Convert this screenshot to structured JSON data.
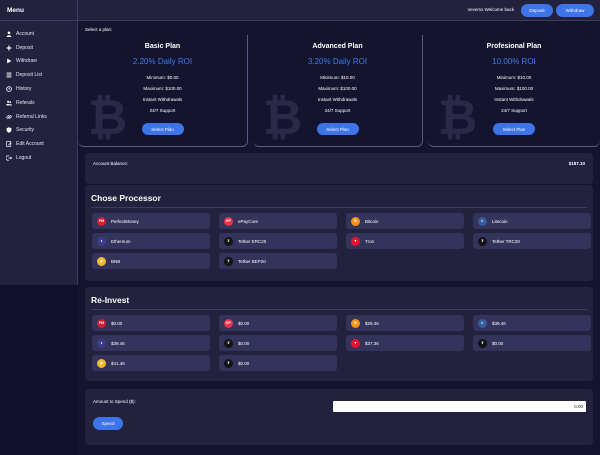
{
  "sidebar": {
    "title": "Menu",
    "items": [
      {
        "label": "Account",
        "icon": "user-icon"
      },
      {
        "label": "Deposit",
        "icon": "plus-icon"
      },
      {
        "label": "Withdraw",
        "icon": "withdraw-icon"
      },
      {
        "label": "Deposit List",
        "icon": "list-icon"
      },
      {
        "label": "History",
        "icon": "history-icon"
      },
      {
        "label": "Referals",
        "icon": "users-icon"
      },
      {
        "label": "Referral Links",
        "icon": "link-icon"
      },
      {
        "label": "Security",
        "icon": "shield-icon"
      },
      {
        "label": "Edit Account",
        "icon": "edit-icon"
      },
      {
        "label": "Logout",
        "icon": "logout-icon"
      }
    ]
  },
  "header": {
    "welcome": "nevemx Welcome back",
    "deposit_label": "Deposit",
    "withdraw_label": "Withdraw"
  },
  "plans": {
    "label": "Select a plan:",
    "items": [
      {
        "name": "Basic Plan",
        "roi": "2.20% Daily ROI",
        "minimum": "Minimum: $0.00",
        "maximum": "Maximum: $100.00",
        "feature1": "Instant Withdrawals",
        "feature2": "24/7 Support",
        "button": "Select Plan"
      },
      {
        "name": "Advanced Plan",
        "roi": "3.20% Daily ROI",
        "minimum": "Minimum: $10.00",
        "maximum": "Maximum: $100.00",
        "feature1": "Instant Withdrawals",
        "feature2": "24/7 Support",
        "button": "Select Plan"
      },
      {
        "name": "Profesional Plan",
        "roi": "10.00% ROI",
        "minimum": "Minimum: $10.00",
        "maximum": "Maximum: $100.00",
        "feature1": "Instant Withdrawals",
        "feature2": "24/7 Support",
        "button": "Select Plan"
      }
    ]
  },
  "balance": {
    "label": "Account Balance:",
    "value": "$187.10"
  },
  "processor": {
    "title": "Chose Processor",
    "items": [
      {
        "label": "PerfectMoney",
        "icon": "pm-icon",
        "color": "#d21f2f",
        "glyph": "PM"
      },
      {
        "label": "ePayCore",
        "icon": "epaycore-icon",
        "color": "#e8334a",
        "glyph": "EP"
      },
      {
        "label": "Bitcoin",
        "icon": "bitcoin-icon",
        "color": "#f7931a",
        "glyph": "B"
      },
      {
        "label": "Litecoin",
        "icon": "litecoin-icon",
        "color": "#345d9d",
        "glyph": "Ł"
      },
      {
        "label": "Ethereum",
        "icon": "ethereum-icon",
        "color": "#3c3c8d",
        "glyph": "♦"
      },
      {
        "label": "Tether ERC20",
        "icon": "tether-erc20-icon",
        "color": "#141414",
        "glyph": "₮"
      },
      {
        "label": "Tron",
        "icon": "tron-icon",
        "color": "#e8112d",
        "glyph": "▼"
      },
      {
        "label": "Tether TRC20",
        "icon": "tether-trc20-icon",
        "color": "#141414",
        "glyph": "₮"
      },
      {
        "label": "BNB",
        "icon": "bnb-icon",
        "color": "#f3ba2f",
        "glyph": "◆"
      },
      {
        "label": "Tether BEP20",
        "icon": "tether-bep20-icon",
        "color": "#141414",
        "glyph": "₮"
      }
    ]
  },
  "reinvest": {
    "title": "Re-Invest",
    "items": [
      {
        "label": "$0.00",
        "icon": "pm-icon",
        "color": "#d21f2f",
        "glyph": "PM"
      },
      {
        "label": "$0.00",
        "icon": "epaycore-icon",
        "color": "#e8334a",
        "glyph": "EP"
      },
      {
        "label": "$29.46",
        "icon": "bitcoin-icon",
        "color": "#f7931a",
        "glyph": "B"
      },
      {
        "label": "$39.46",
        "icon": "litecoin-icon",
        "color": "#345d9d",
        "glyph": "Ł"
      },
      {
        "label": "$39.46",
        "icon": "ethereum-icon",
        "color": "#3c3c8d",
        "glyph": "♦"
      },
      {
        "label": "$0.00",
        "icon": "tether-erc20-icon",
        "color": "#141414",
        "glyph": "₮"
      },
      {
        "label": "$37.36",
        "icon": "tron-icon",
        "color": "#e8112d",
        "glyph": "▼"
      },
      {
        "label": "$0.00",
        "icon": "tether-trc20-icon",
        "color": "#141414",
        "glyph": "₮"
      },
      {
        "label": "$41.46",
        "icon": "bnb-icon",
        "color": "#f3ba2f",
        "glyph": "◆"
      },
      {
        "label": "$0.00",
        "icon": "tether-bep20-icon",
        "color": "#141414",
        "glyph": "₮"
      }
    ]
  },
  "spend": {
    "label": "Amount to Spend ($):",
    "value": "0.00",
    "button": "Spend"
  },
  "colors": {
    "accent": "#3d74e8",
    "background": "#14142e",
    "panel": "#22223f",
    "chip": "#33335c"
  }
}
